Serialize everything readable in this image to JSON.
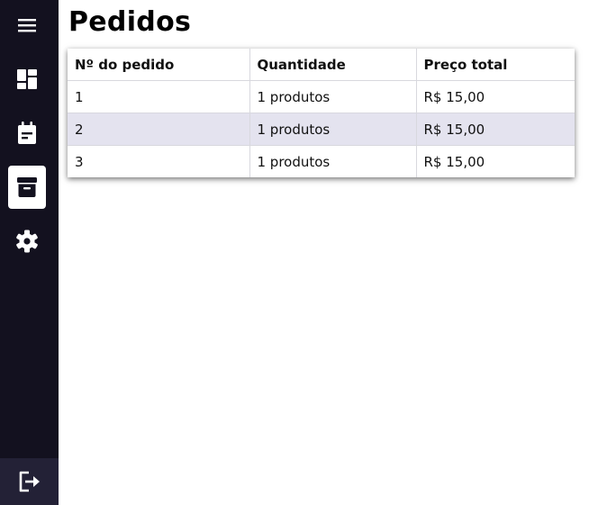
{
  "page": {
    "title": "Pedidos"
  },
  "sidebar": {
    "menu_icon": "hamburger-menu-icon",
    "items": [
      {
        "id": "dashboard",
        "icon": "dashboard-icon",
        "active": false
      },
      {
        "id": "calendar",
        "icon": "calendar-icon",
        "active": false
      },
      {
        "id": "orders",
        "icon": "archive-box-icon",
        "active": true
      },
      {
        "id": "settings",
        "icon": "gear-icon",
        "active": false
      }
    ],
    "logout_icon": "logout-icon"
  },
  "orders_table": {
    "columns": [
      "Nº do pedido",
      "Quantidade",
      "Preço total"
    ],
    "rows": [
      [
        "1",
        "1 produtos",
        "R$ 15,00"
      ],
      [
        "2",
        "1 produtos",
        "R$ 15,00"
      ],
      [
        "3",
        "1 produtos",
        "R$ 15,00"
      ]
    ]
  },
  "colors": {
    "sidebar_bg": "#13111f",
    "logout_bg": "#232136",
    "row_stripe": "#e4e3ef",
    "active_item_bg": "#ffffff"
  }
}
